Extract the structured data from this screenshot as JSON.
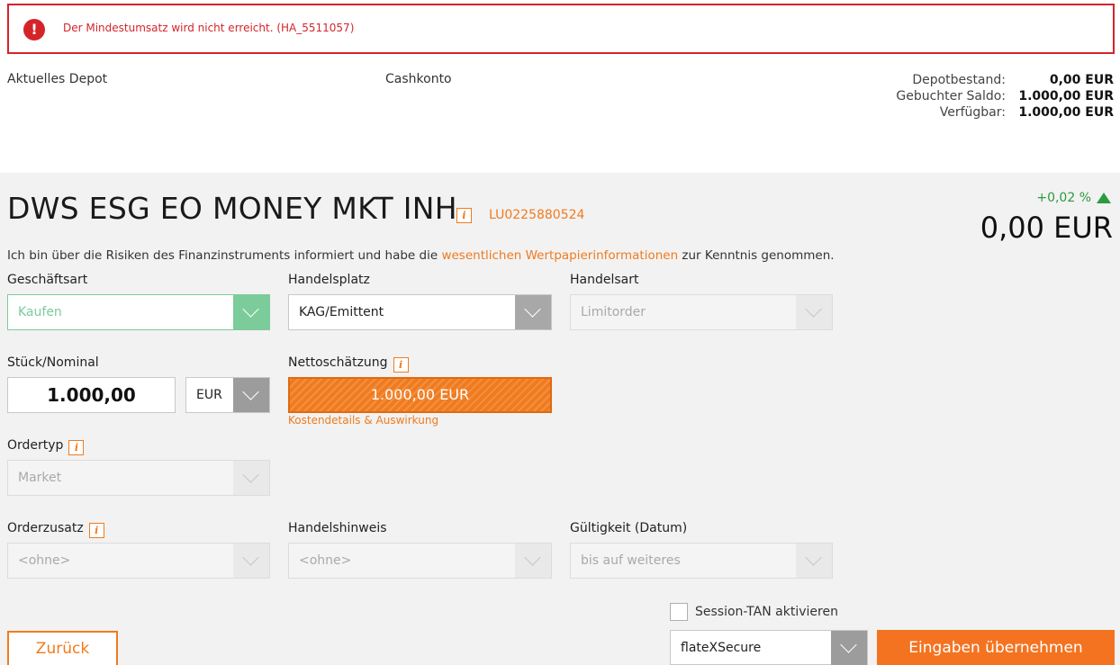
{
  "error": {
    "icon": "exclamation-icon",
    "message": "Der Mindestumsatz wird nicht erreicht.  (HA_5511057)"
  },
  "account": {
    "depot_label": "Aktuelles Depot",
    "cash_label": "Cashkonto",
    "summary": [
      {
        "label": "Depotbestand:",
        "value": "0,00 EUR"
      },
      {
        "label": "Gebuchter Saldo:",
        "value": "1.000,00 EUR"
      },
      {
        "label": "Verfügbar:",
        "value": "1.000,00 EUR"
      }
    ]
  },
  "security": {
    "name": "DWS ESG EO MONEY MKT INH",
    "isin": "LU0225880524",
    "change": "+0,02 %",
    "price": "0,00 EUR",
    "risk_text_before": "Ich bin über die Risiken des Finanzinstruments informiert und habe die ",
    "risk_link": "wesentlichen Wertpapierinformationen",
    "risk_text_after": " zur Kenntnis genommen."
  },
  "form": {
    "geschaeftsart": {
      "label": "Geschäftsart",
      "value": "Kaufen"
    },
    "handelsplatz": {
      "label": "Handelsplatz",
      "value": "KAG/Emittent"
    },
    "handelsart": {
      "label": "Handelsart",
      "value": "Limitorder"
    },
    "stueck": {
      "label": "Stück/Nominal",
      "value": "1.000,00",
      "currency": "EUR"
    },
    "netto": {
      "label": "Nettoschätzung",
      "value": "1.000,00 EUR",
      "link": "Kostendetails & Auswirkung"
    },
    "ordertyp": {
      "label": "Ordertyp",
      "value": "Market"
    },
    "orderzusatz": {
      "label": "Orderzusatz",
      "value": "<ohne>"
    },
    "handelshinweis": {
      "label": "Handelshinweis",
      "value": "<ohne>"
    },
    "gueltigkeit": {
      "label": "Gültigkeit (Datum)",
      "value": "bis auf weiteres"
    }
  },
  "footer": {
    "session_tan_label": "Session-TAN aktivieren",
    "tan_method": "flateXSecure",
    "back_label": "Zurück",
    "submit_label": "Eingaben übernehmen"
  },
  "colors": {
    "accent": "#f07b1e",
    "error": "#d4242a",
    "positive": "#2a9b3e",
    "active_select": "#7ccb9a"
  }
}
